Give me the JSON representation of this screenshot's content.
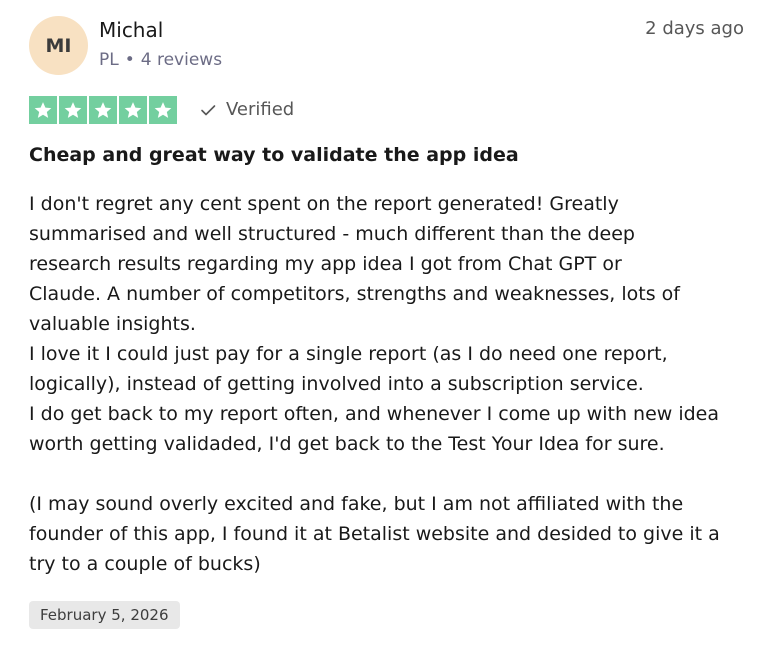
{
  "reviewer": {
    "initials": "MI",
    "name": "Michal",
    "country": "PL",
    "reviews_count": "4 reviews"
  },
  "posted_relative": "2 days ago",
  "rating": {
    "stars": 5,
    "max": 5,
    "star_color": "#73cf9f",
    "icon": "star-icon"
  },
  "verified_label": "Verified",
  "review": {
    "title": "Cheap and great way to validate the app idea",
    "body_lines": [
      "I don't regret any cent spent on the report generated! Greatly",
      "summarised and well structured - much different than the deep",
      "research results regarding my app idea I got from Chat GPT or",
      "Claude. A number of competitors, strengths and weaknesses, lots of",
      "valuable insights.",
      "I love it I could just pay for a single report (as I do need one report,",
      "logically), instead of getting involved into a subscription service.",
      "I do get back to my report often, and whenever I come up with new idea",
      "worth getting validaded, I'd get back to the Test Your Idea for sure."
    ],
    "body_lines_2": [
      "(I may sound overly excited and fake, but I am not affiliated with the",
      "founder of this app, I found it at Betalist website and desided to give it a",
      "try to a couple of bucks)"
    ]
  },
  "experience_date": "February 5, 2026"
}
